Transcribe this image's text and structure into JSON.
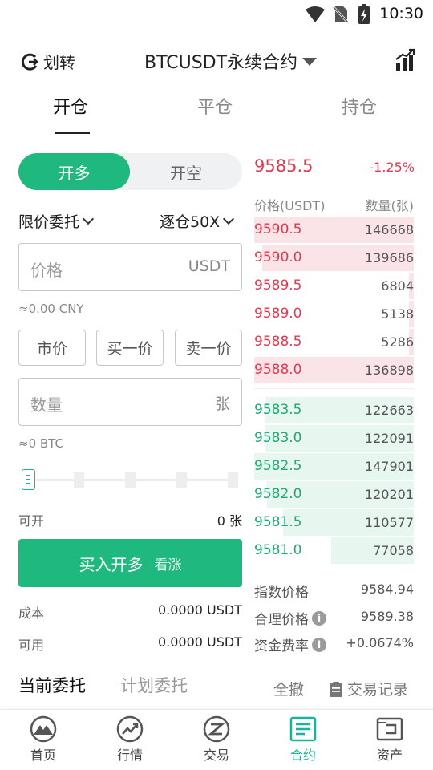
{
  "status_bar": {
    "time": "10:30"
  },
  "header": {
    "transfer_label": "划转",
    "title": "BTCUSDT永续合约"
  },
  "tabs": [
    {
      "label": "开仓",
      "active": true
    },
    {
      "label": "平仓",
      "active": false
    },
    {
      "label": "持仓",
      "active": false
    }
  ],
  "order_form": {
    "side_long": "开多",
    "side_short": "开空",
    "order_type": "限价委托",
    "margin_mode": "逐仓50X",
    "price_placeholder": "价格",
    "price_unit": "USDT",
    "price_cny_hint": "≈0.00 CNY",
    "quick_buttons": [
      "市价",
      "买一价",
      "卖一价"
    ],
    "qty_placeholder": "数量",
    "qty_unit": "张",
    "qty_btc_hint": "≈0 BTC",
    "slider_level": 0,
    "available_open_label": "可开",
    "available_open_value": "0 张",
    "buy_button": "买入开多",
    "buy_button_sub": "看涨",
    "cost_label": "成本",
    "cost_value": "0.0000 USDT",
    "available_label": "可用",
    "available_value": "0.0000 USDT"
  },
  "order_book": {
    "last_price": "9585.5",
    "change": "-1.25%",
    "price_header": "价格(USDT)",
    "qty_header": "数量(张)",
    "asks": [
      {
        "price": "9590.5",
        "qty": "146668",
        "depth": 1.0
      },
      {
        "price": "9590.0",
        "qty": "139686",
        "depth": 0.95
      },
      {
        "price": "9589.5",
        "qty": "6804",
        "depth": 0.03
      },
      {
        "price": "9589.0",
        "qty": "5138",
        "depth": 0.03
      },
      {
        "price": "9588.5",
        "qty": "5286",
        "depth": 0.03
      },
      {
        "price": "9588.0",
        "qty": "136898",
        "depth": 1.0
      }
    ],
    "bids": [
      {
        "price": "9583.5",
        "qty": "122663",
        "depth": 0.93
      },
      {
        "price": "9583.0",
        "qty": "122091",
        "depth": 0.93
      },
      {
        "price": "9582.5",
        "qty": "147901",
        "depth": 1.0
      },
      {
        "price": "9582.0",
        "qty": "120201",
        "depth": 0.92
      },
      {
        "price": "9581.5",
        "qty": "110577",
        "depth": 0.82
      },
      {
        "price": "9581.0",
        "qty": "77058",
        "depth": 0.52
      }
    ],
    "index_price_label": "指数价格",
    "index_price_value": "9584.94",
    "fair_price_label": "合理价格",
    "fair_price_value": "9589.38",
    "funding_rate_label": "资金费率",
    "funding_rate_value": "+0.0674%"
  },
  "orders": {
    "current_tab": "当前委托",
    "plan_tab": "计划委托",
    "cancel_all": "全撤",
    "trade_records": "交易记录"
  },
  "bottom_nav": [
    {
      "label": "首页",
      "icon": "home-icon",
      "active": false
    },
    {
      "label": "行情",
      "icon": "market-icon",
      "active": false
    },
    {
      "label": "交易",
      "icon": "trade-icon",
      "active": false
    },
    {
      "label": "合约",
      "icon": "contract-icon",
      "active": true
    },
    {
      "label": "资产",
      "icon": "wallet-icon",
      "active": false
    }
  ],
  "colors": {
    "accent_green": "#1fb87e",
    "ask_red": "#e03a4f",
    "nav_active": "#17b59e"
  }
}
